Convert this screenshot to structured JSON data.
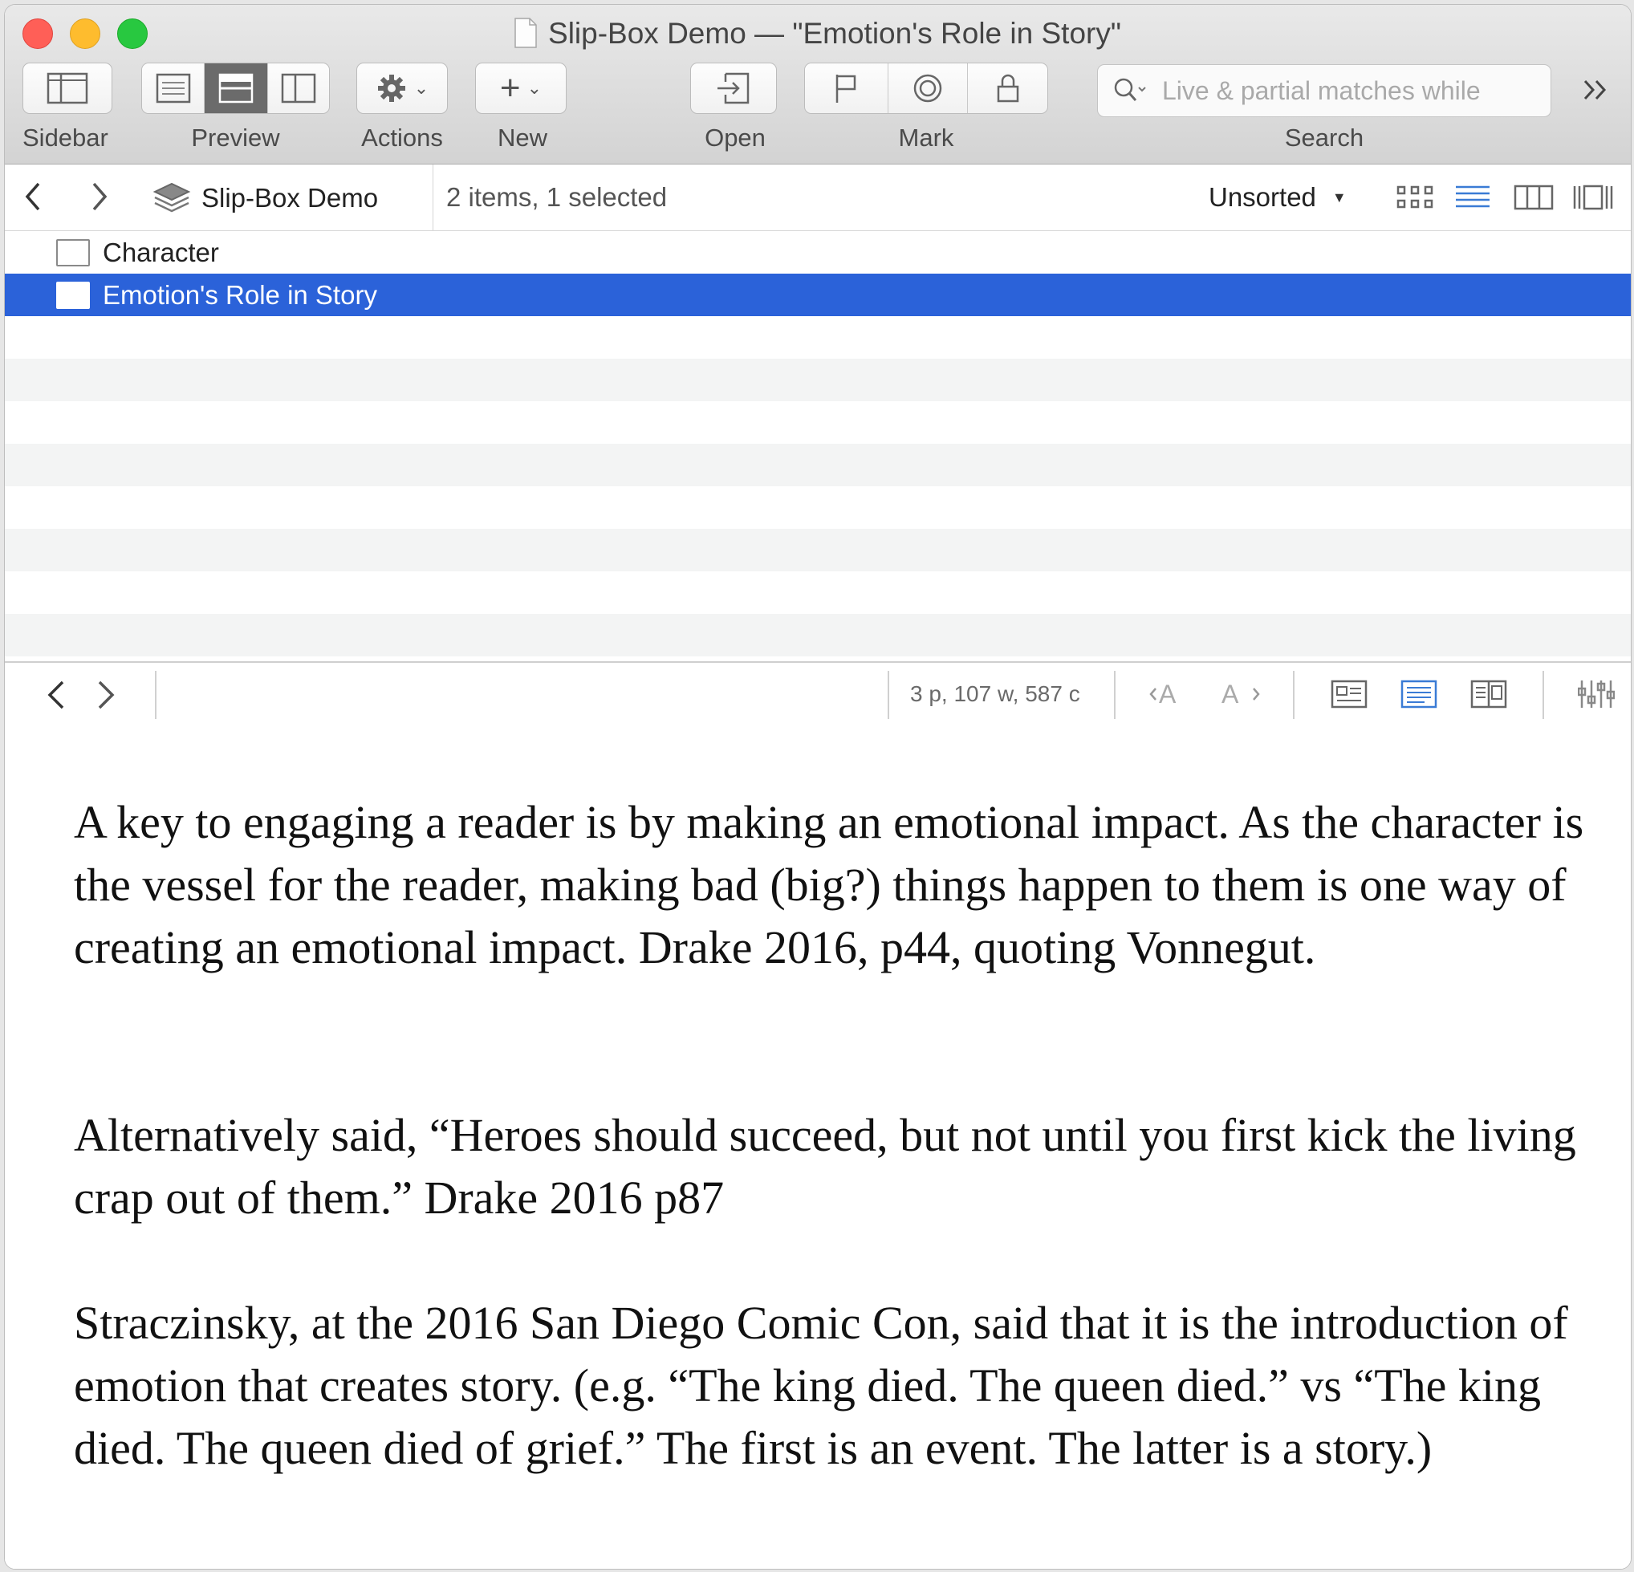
{
  "window": {
    "title": "Slip-Box Demo — \"Emotion's Role in Story\""
  },
  "toolbar": {
    "sidebar_label": "Sidebar",
    "preview_label": "Preview",
    "actions_label": "Actions",
    "new_label": "New",
    "open_label": "Open",
    "mark_label": "Mark",
    "search_label": "Search",
    "search_placeholder": "Live & partial matches while"
  },
  "pathbar": {
    "crumb": "Slip-Box Demo",
    "count": "2 items, 1 selected",
    "sort": "Unsorted"
  },
  "list": {
    "items": [
      {
        "label": "Character",
        "selected": false
      },
      {
        "label": "Emotion's Role in Story",
        "selected": true
      }
    ]
  },
  "editor": {
    "stats": "3 p, 107 w, 587 c",
    "paragraphs": [
      "A key to engaging a reader is by making an emotional impact. As the character is the vessel for the reader, making bad (big?) things happen to them is one way of creating an emotional impact. Drake 2016, p44, quoting Vonnegut.",
      "Alternatively said, “Heroes should succeed, but not until you first kick the living crap out of them.” Drake 2016 p87",
      "Straczinsky, at the 2016 San Diego Comic Con, said that it is the introduction of emotion that creates story. (e.g. “The king died. The queen died.” vs “The king died. The queen died of grief.” The first is an event. The latter is a story.)"
    ]
  },
  "colors": {
    "selection": "#2b62d9",
    "accent_icon": "#3a7bd5"
  }
}
